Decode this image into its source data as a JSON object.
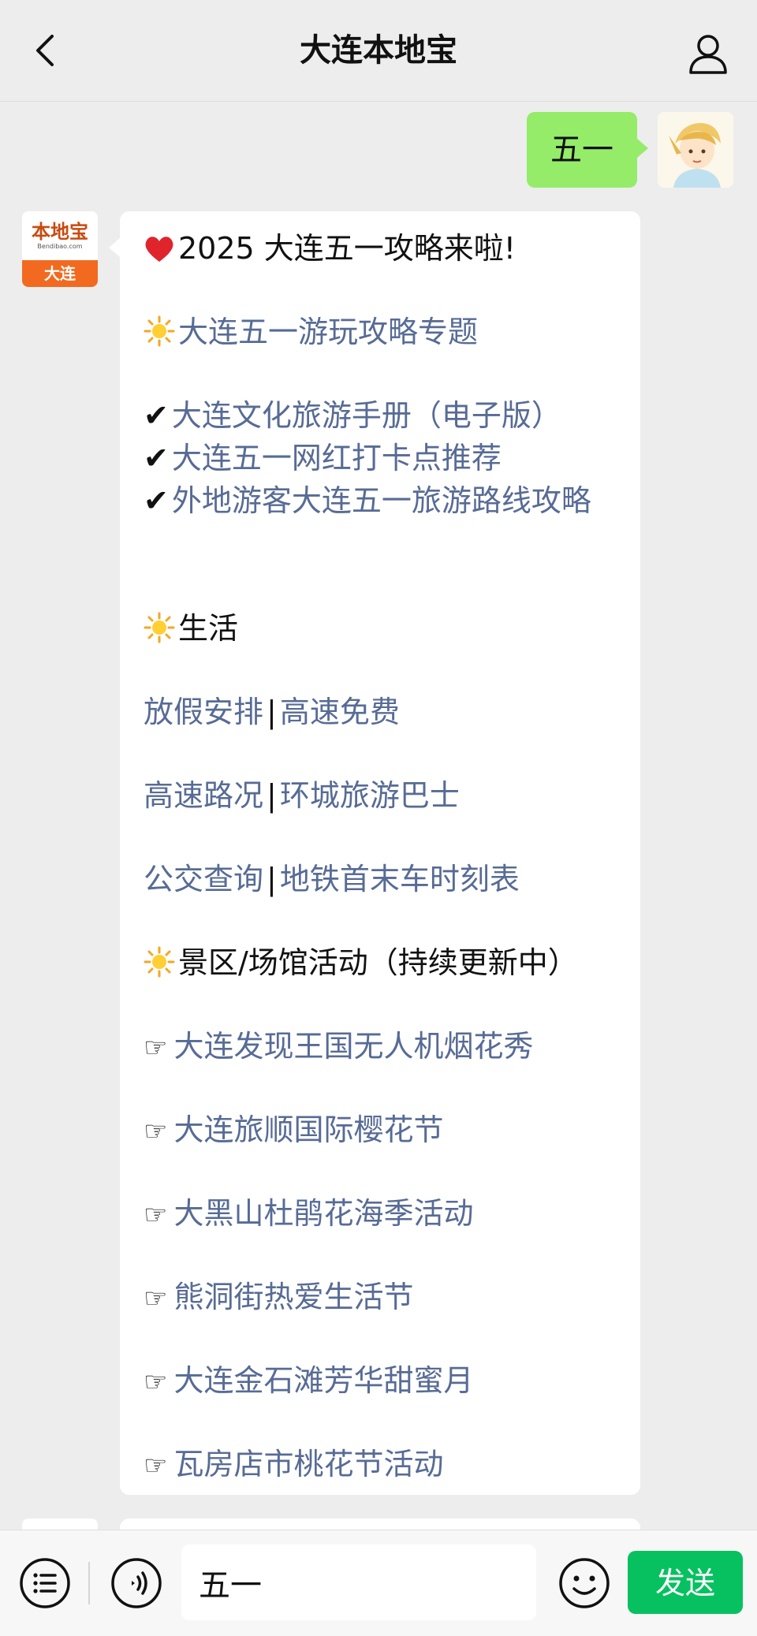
{
  "header": {
    "title": "大连本地宝"
  },
  "outgoing": {
    "text": "五一"
  },
  "bot": {
    "logo_text": "本地宝",
    "logo_sub": "Bendibao.com",
    "logo_city": "大连"
  },
  "message": {
    "headline": "2025 大连五一攻略来啦!",
    "topic_link": "大连五一游玩攻略专题",
    "travel_links": [
      "大连文化旅游手册（电子版）",
      "大连五一网红打卡点推荐",
      "外地游客大连五一旅游路线攻略"
    ],
    "life_heading": "生活",
    "life_rows": [
      {
        "a": "放假安排",
        "b": "高速免费"
      },
      {
        "a": "高速路况",
        "b": "环城旅游巴士"
      },
      {
        "a": "公交查询",
        "b": "地铁首末车时刻表"
      }
    ],
    "separator": "|",
    "venue_heading": "景区/场馆活动（持续更新中）",
    "venue_links": [
      "大连发现王国无人机烟花秀",
      "大连旅顺国际樱花节",
      "大黑山杜鹃花海季活动",
      "熊洞街热爱生活节",
      "大连金石滩芳华甜蜜月",
      "瓦房店市桃花节活动"
    ]
  },
  "input_bar": {
    "input_value": "五一",
    "send_label": "发送"
  },
  "colors": {
    "background": "#ededed",
    "outgoing_bubble": "#95ec69",
    "link": "#576b95",
    "send_button": "#07c160",
    "logo_orange": "#f26a1f"
  },
  "icons": [
    "back-arrow-icon",
    "profile-icon",
    "heart-icon",
    "sun-icon",
    "checkmark-icon",
    "pointing-hand-icon",
    "menu-list-icon",
    "voice-icon",
    "emoji-icon"
  ]
}
